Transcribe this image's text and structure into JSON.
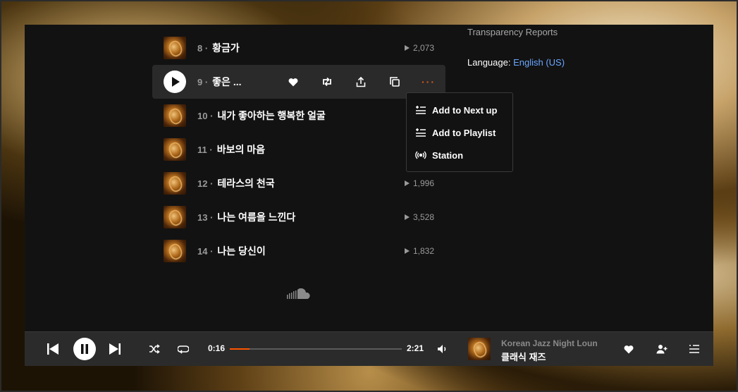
{
  "footer": {
    "transparency_label": "Transparency Reports",
    "language_label": "Language:",
    "language_value": "English (US)"
  },
  "tracks": [
    {
      "num": "8 ·",
      "title": "황금가",
      "plays": "2,073"
    },
    {
      "num": "9 ·",
      "title": "좋은 ..."
    },
    {
      "num": "10 ·",
      "title": "내가 좋아하는 행복한 얼굴"
    },
    {
      "num": "11 ·",
      "title": "바보의 마음"
    },
    {
      "num": "12 ·",
      "title": "테라스의 천국",
      "plays": "1,996"
    },
    {
      "num": "13 ·",
      "title": "나는 여름을 느낀다",
      "plays": "3,528"
    },
    {
      "num": "14 ·",
      "title": "나는 당신이",
      "plays": "1,832"
    }
  ],
  "row_actions": {
    "like_icon": "heart-icon",
    "repost_icon": "repost-icon",
    "share_icon": "share-icon",
    "copy_icon": "copy-link-icon",
    "more_icon": "more-dots-icon",
    "more_label": "···"
  },
  "context_menu": {
    "items": [
      {
        "label": "Add to Next up",
        "icon": "add-next-up-icon"
      },
      {
        "label": "Add to Playlist",
        "icon": "add-playlist-icon"
      },
      {
        "label": "Station",
        "icon": "station-icon"
      }
    ]
  },
  "player": {
    "elapsed": "0:16",
    "duration": "2:21",
    "progress": 0.113,
    "now_playing_artist": "Korean Jazz Night Lounge",
    "now_playing_title": "클래식 재즈"
  },
  "colors": {
    "accent": "#ff5500",
    "link": "#6aa6ff",
    "background": "#121212",
    "player_bar": "#2b2b2b"
  }
}
